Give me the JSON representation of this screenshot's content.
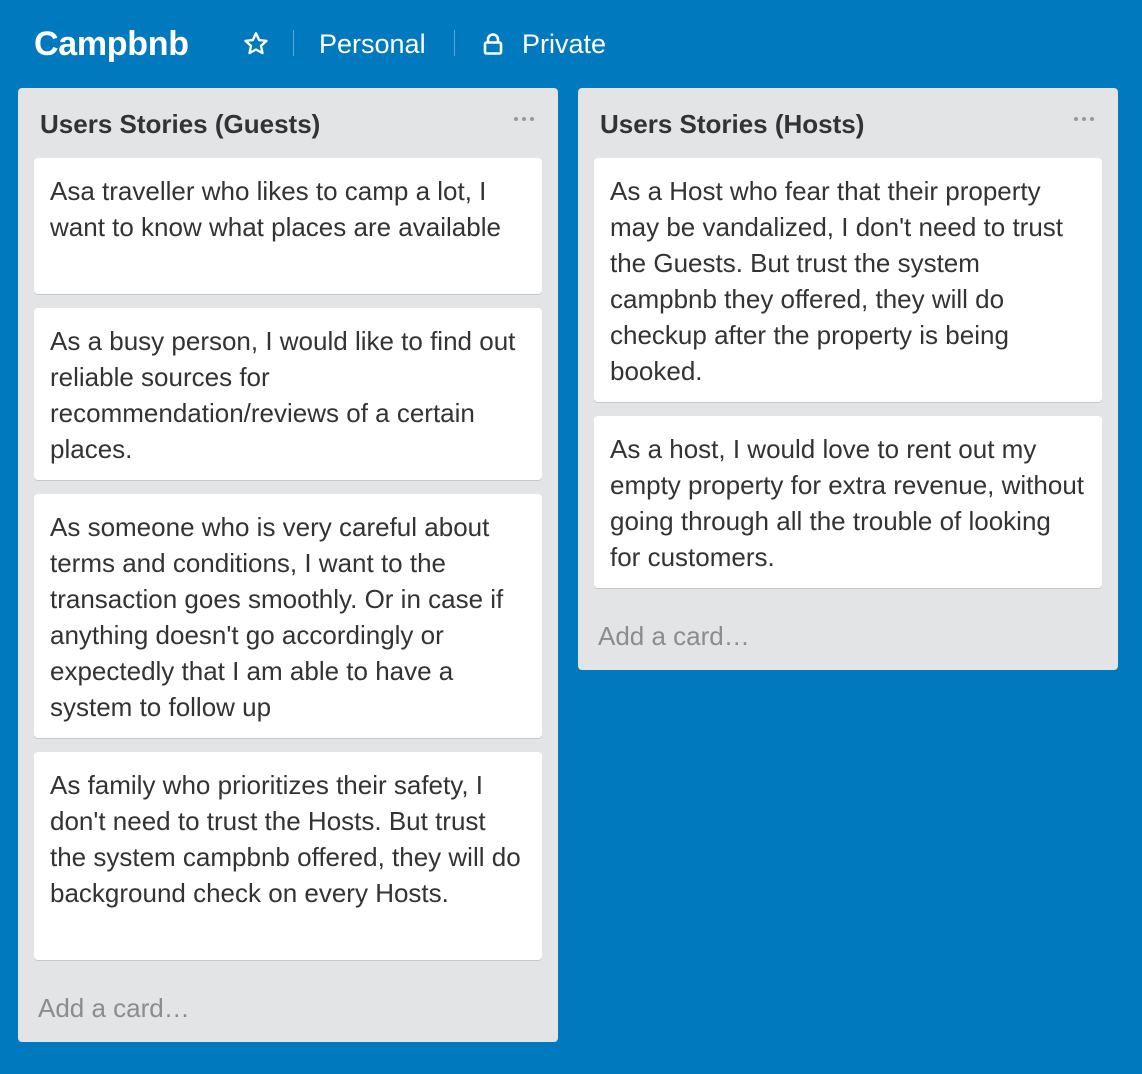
{
  "board": {
    "title": "Campbnb",
    "star_icon": "star-icon",
    "team_label": "Personal",
    "visibility_icon": "lock-icon",
    "visibility_label": "Private"
  },
  "colors": {
    "board_background": "#0079bf",
    "list_background": "#e2e4e6",
    "card_background": "#ffffff",
    "text": "#333333",
    "muted_text": "#8c8c8c"
  },
  "lists": [
    {
      "title": "Users Stories (Guests)",
      "menu_icon": "ellipsis-icon",
      "cards": [
        "Asa traveller who likes to camp a lot, I want to know what places are available",
        "As a busy person, I would like to find out reliable sources for recommendation/reviews of a certain places.",
        "As someone who is very careful about terms and conditions, I want to the transaction goes smoothly. Or in case if anything doesn't go accordingly or expectedly that I am able to have a system to follow up",
        "As family who prioritizes their safety, I don't need to trust the Hosts. But trust the system campbnb offered, they will do background check on every Hosts."
      ],
      "add_card_label": "Add a card…"
    },
    {
      "title": "Users Stories (Hosts)",
      "menu_icon": "ellipsis-icon",
      "cards": [
        "As a Host who fear that their property may be vandalized, I don't need to trust the Guests. But trust the system campbnb they offered, they will do checkup after the property is being booked.",
        "As a host, I would love to rent out my empty property for extra revenue, without going through all the trouble of looking for customers."
      ],
      "add_card_label": "Add a card…"
    }
  ]
}
